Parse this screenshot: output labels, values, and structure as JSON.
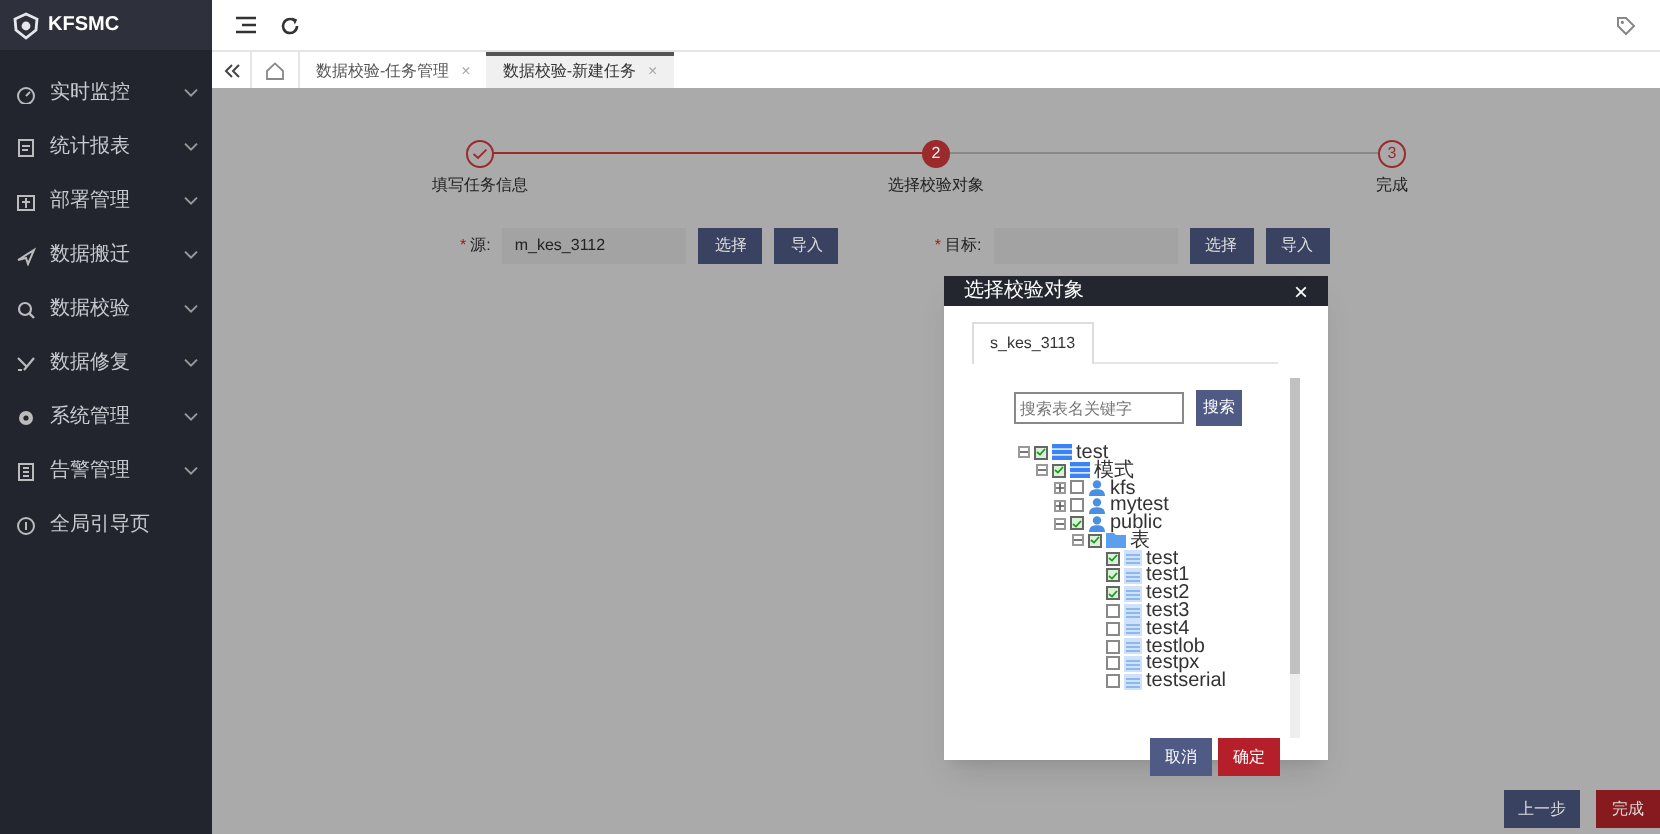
{
  "app": {
    "logo_text": "KFSMC"
  },
  "sidebar": {
    "items": [
      {
        "label": "实时监控",
        "expandable": true
      },
      {
        "label": "统计报表",
        "expandable": true
      },
      {
        "label": "部署管理",
        "expandable": true
      },
      {
        "label": "数据搬迁",
        "expandable": true
      },
      {
        "label": "数据校验",
        "expandable": true
      },
      {
        "label": "数据修复",
        "expandable": true
      },
      {
        "label": "系统管理",
        "expandable": true
      },
      {
        "label": "告警管理",
        "expandable": true
      },
      {
        "label": "全局引导页",
        "expandable": false
      }
    ]
  },
  "tabs": [
    {
      "label": "数据校验-任务管理",
      "close": "×",
      "selected": false
    },
    {
      "label": "数据校验-新建任务",
      "close": "×",
      "selected": true
    }
  ],
  "steps": [
    {
      "label": "填写任务信息",
      "done": true,
      "active": false
    },
    {
      "number": "2",
      "label": "选择校验对象",
      "done": false,
      "active": true
    },
    {
      "number": "3",
      "label": "完成",
      "done": false,
      "active": false
    }
  ],
  "form": {
    "fields": [
      {
        "required_mark": "*",
        "label": "源:",
        "value": "m_kes_3112",
        "buttons": [
          "选择",
          "导入"
        ]
      },
      {
        "required_mark": "*",
        "label": "目标:",
        "buttons": [
          "选择",
          "导入"
        ]
      }
    ]
  },
  "dialog": {
    "title": "选择校验对象",
    "close": "×",
    "tabs": [
      {
        "label": "s_kes_3113",
        "selected": true
      }
    ],
    "search": {
      "placeholder": "搜索表名关键字",
      "button": "搜索"
    },
    "tree": [
      {
        "label": "test",
        "kind": "database",
        "checked": true,
        "expanded": true,
        "children": [
          {
            "label": "模式",
            "kind": "database",
            "checked": true,
            "expanded": true,
            "children": [
              {
                "label": "kfs",
                "kind": "schema",
                "checked": false,
                "expanded": false
              },
              {
                "label": "mytest",
                "kind": "schema",
                "checked": false,
                "expanded": false
              },
              {
                "label": "public",
                "kind": "schema",
                "checked": true,
                "expanded": true,
                "children": [
                  {
                    "label": "表",
                    "kind": "folder",
                    "checked": true,
                    "expanded": true,
                    "children": [
                      {
                        "label": "test",
                        "kind": "table",
                        "checked": true
                      },
                      {
                        "label": "test1",
                        "kind": "table",
                        "checked": true
                      },
                      {
                        "label": "test2",
                        "kind": "table",
                        "checked": true
                      },
                      {
                        "label": "test3",
                        "kind": "table",
                        "checked": false
                      },
                      {
                        "label": "test4",
                        "kind": "table",
                        "checked": false
                      },
                      {
                        "label": "testlob",
                        "kind": "table",
                        "checked": false
                      },
                      {
                        "label": "testpx",
                        "kind": "table",
                        "checked": false
                      },
                      {
                        "label": "testserial",
                        "kind": "table",
                        "checked": false
                      }
                    ]
                  }
                ]
              }
            ]
          }
        ]
      }
    ],
    "buttons": [
      {
        "label": "取消",
        "kind": "secondary"
      },
      {
        "label": "确定",
        "kind": "primary"
      }
    ]
  },
  "footer": {
    "buttons": [
      {
        "label": "上一步",
        "kind": "secondary"
      },
      {
        "label": "完成",
        "kind": "primary"
      }
    ]
  }
}
